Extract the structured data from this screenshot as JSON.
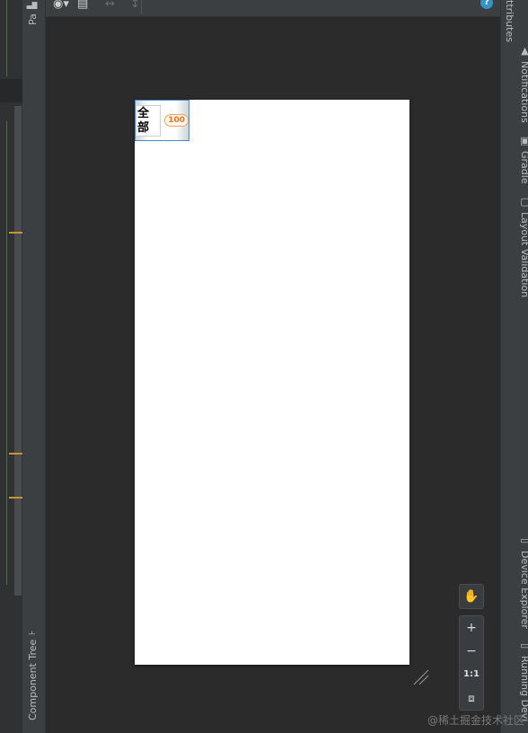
{
  "left_tool_window": {
    "palette_label": "Pa",
    "component_tree_label": "Component Tree"
  },
  "toolbar": {
    "eye_icon": "eye-icon",
    "layout_icon": "layout-icon",
    "help_label": "?"
  },
  "design": {
    "tab_label": "全部",
    "badge_count": "100"
  },
  "zoom": {
    "pan_icon": "hand-icon",
    "zoom_in": "+",
    "zoom_out": "−",
    "actual_size": "1:1",
    "fit_icon": "fit-screen-icon"
  },
  "right_tool_window": {
    "attributes": "ttributes",
    "notifications": "Notifications",
    "gradle": "Gradle",
    "layout_validation": "Layout Validation",
    "device_explorer": "Device Explorer",
    "running_devices": "Running Devi"
  },
  "watermark": "@稀土掘金技术社区"
}
